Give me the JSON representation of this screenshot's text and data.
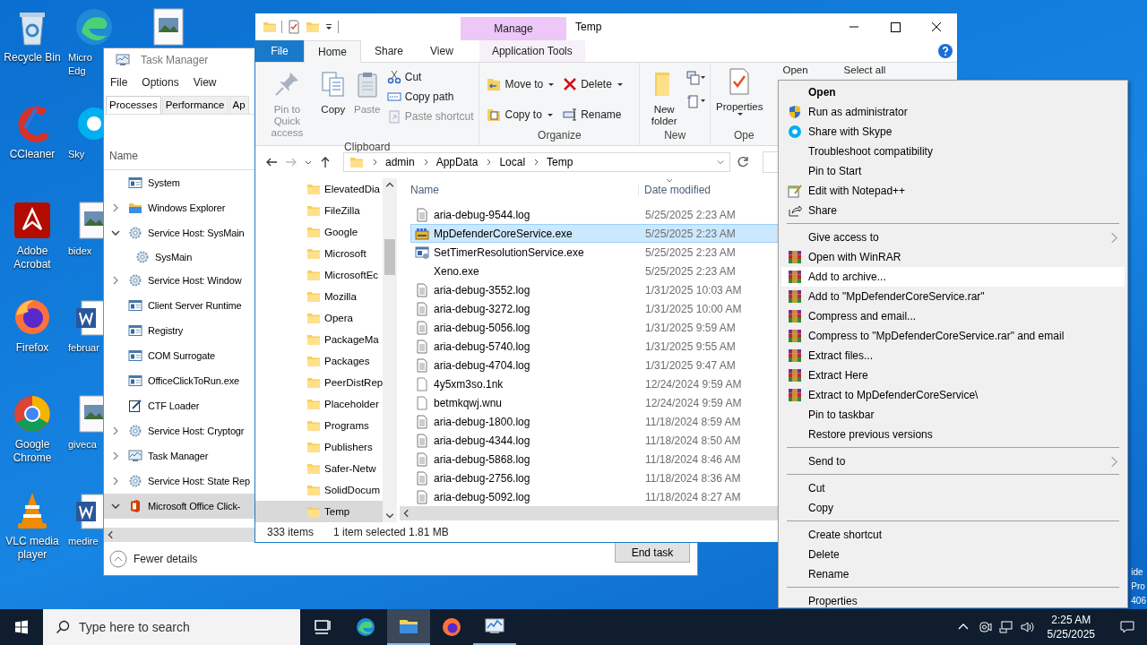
{
  "desktop_column_1": [
    {
      "label": "Recycle Bin",
      "kind": "recycle-bin"
    },
    {
      "label": "CCleaner",
      "kind": "ccleaner"
    },
    {
      "label": "Adobe Acrobat",
      "kind": "acrobat"
    },
    {
      "label": "Firefox",
      "kind": "firefox"
    },
    {
      "label": "Google Chrome",
      "kind": "chrome"
    },
    {
      "label": "VLC media player",
      "kind": "vlc"
    }
  ],
  "desktop_column_2": [
    {
      "label": "Micro Edg",
      "kind": "edge"
    },
    {
      "label": "Sky",
      "kind": "skype"
    },
    {
      "label": "bidex",
      "kind": "image"
    },
    {
      "label": "februar",
      "kind": "word"
    },
    {
      "label": "giveca",
      "kind": "image"
    },
    {
      "label": "medire",
      "kind": "word"
    }
  ],
  "desktop_corner_text": [
    "ide",
    "Pro",
    "406"
  ],
  "task_manager": {
    "title": "Task Manager",
    "menu": [
      "File",
      "Options",
      "View"
    ],
    "tabs": [
      {
        "label": "Processes",
        "selected": true
      },
      {
        "label": "Performance",
        "selected": false
      },
      {
        "label": "Ap",
        "selected": false
      }
    ],
    "column": "Name",
    "processes": [
      {
        "name": "System",
        "kind": "process",
        "selected": false
      },
      {
        "name": "Windows Explorer",
        "kind": "explorer",
        "expanded": false,
        "selected": false
      },
      {
        "name": "Service Host: SysMain",
        "kind": "service-host",
        "expanded": true,
        "selected": false,
        "children": [
          {
            "name": "SysMain",
            "kind": "service",
            "selected": false
          }
        ]
      },
      {
        "name": "Service Host: Window",
        "kind": "service-host",
        "expanded": false,
        "selected": false
      },
      {
        "name": "Client Server Runtime",
        "kind": "process",
        "selected": false
      },
      {
        "name": "Registry",
        "kind": "process",
        "selected": false
      },
      {
        "name": "COM Surrogate",
        "kind": "process",
        "selected": false
      },
      {
        "name": "OfficeClickToRun.exe",
        "kind": "process",
        "selected": false
      },
      {
        "name": "CTF Loader",
        "kind": "pen",
        "selected": false
      },
      {
        "name": "Service Host: Cryptogr",
        "kind": "service-host",
        "expanded": false,
        "selected": false
      },
      {
        "name": "Task Manager",
        "kind": "task-manager",
        "expanded": false,
        "selected": false
      },
      {
        "name": "Service Host: State Rep",
        "kind": "service-host",
        "expanded": false,
        "selected": false
      },
      {
        "name": "Microsoft Office Click-",
        "kind": "office",
        "expanded": true,
        "selected": true
      }
    ],
    "fewer_details": "Fewer details",
    "end_task": "End task"
  },
  "explorer": {
    "title": "Temp",
    "context_group": "Manage",
    "ribbon_tabs": [
      {
        "label": "File",
        "kind": "file",
        "selected": false
      },
      {
        "label": "Home",
        "kind": "tab",
        "selected": true
      },
      {
        "label": "Share",
        "kind": "tab",
        "selected": false
      },
      {
        "label": "View",
        "kind": "tab",
        "selected": false
      },
      {
        "label": "Application Tools",
        "kind": "context",
        "selected": false
      }
    ],
    "clipboard": {
      "label": "Clipboard",
      "large": [
        {
          "label": "Pin to Quick access",
          "kind": "pin",
          "disabled": true
        },
        {
          "label": "Copy",
          "kind": "copy",
          "disabled": false
        },
        {
          "label": "Paste",
          "kind": "paste",
          "disabled": true
        }
      ],
      "small": [
        {
          "label": "Cut",
          "kind": "cut",
          "disabled": false
        },
        {
          "label": "Copy path",
          "kind": "path",
          "disabled": false
        },
        {
          "label": "Paste shortcut",
          "kind": "shortcut",
          "disabled": true
        }
      ]
    },
    "organize": {
      "label": "Organize",
      "columns": [
        [
          {
            "label": "Move to",
            "kind": "move",
            "dropdown": true
          },
          {
            "label": "Copy to",
            "kind": "copyto",
            "dropdown": true
          }
        ],
        [
          {
            "label": "Delete",
            "kind": "delete",
            "dropdown": true
          },
          {
            "label": "Rename",
            "kind": "rename",
            "dropdown": false
          }
        ]
      ]
    },
    "new": {
      "label": "New",
      "large": "New folder"
    },
    "open": {
      "label": "Ope",
      "properties": "Properties",
      "small": [
        "Open",
        "Select all"
      ]
    },
    "address": [
      "admin",
      "AppData",
      "Local",
      "Temp"
    ],
    "nav": [
      {
        "label": "ElevatedDia",
        "selected": false
      },
      {
        "label": "FileZilla",
        "selected": false
      },
      {
        "label": "Google",
        "selected": false
      },
      {
        "label": "Microsoft",
        "selected": false
      },
      {
        "label": "MicrosoftEc",
        "selected": false
      },
      {
        "label": "Mozilla",
        "selected": false
      },
      {
        "label": "Opera",
        "selected": false
      },
      {
        "label": "PackageMa",
        "selected": false
      },
      {
        "label": "Packages",
        "selected": false
      },
      {
        "label": "PeerDistRep",
        "selected": false
      },
      {
        "label": "Placeholder",
        "selected": false
      },
      {
        "label": "Programs",
        "selected": false
      },
      {
        "label": "Publishers",
        "selected": false
      },
      {
        "label": "Safer-Netw",
        "selected": false
      },
      {
        "label": "SolidDocum",
        "selected": false
      },
      {
        "label": "Temp",
        "selected": true
      }
    ],
    "columns": [
      "Name",
      "Date modified"
    ],
    "files": [
      {
        "name": "aria-debug-9544.log",
        "date": "5/25/2025 2:23 AM",
        "kind": "log",
        "selected": false
      },
      {
        "name": "MpDefenderCoreService.exe",
        "date": "5/25/2025 2:23 AM",
        "kind": "package",
        "selected": true
      },
      {
        "name": "SetTimerResolutionService.exe",
        "date": "5/25/2025 2:23 AM",
        "kind": "program",
        "selected": false
      },
      {
        "name": "Xeno.exe",
        "date": "5/25/2025 2:23 AM",
        "kind": "none",
        "selected": false
      },
      {
        "name": "aria-debug-3552.log",
        "date": "1/31/2025 10:03 AM",
        "kind": "log",
        "selected": false
      },
      {
        "name": "aria-debug-3272.log",
        "date": "1/31/2025 10:00 AM",
        "kind": "log",
        "selected": false
      },
      {
        "name": "aria-debug-5056.log",
        "date": "1/31/2025 9:59 AM",
        "kind": "log",
        "selected": false
      },
      {
        "name": "aria-debug-5740.log",
        "date": "1/31/2025 9:55 AM",
        "kind": "log",
        "selected": false
      },
      {
        "name": "aria-debug-4704.log",
        "date": "1/31/2025 9:47 AM",
        "kind": "log",
        "selected": false
      },
      {
        "name": "4y5xm3so.1nk",
        "date": "12/24/2024 9:59 AM",
        "kind": "blank",
        "selected": false
      },
      {
        "name": "betmkqwj.wnu",
        "date": "12/24/2024 9:59 AM",
        "kind": "blank",
        "selected": false
      },
      {
        "name": "aria-debug-1800.log",
        "date": "11/18/2024 8:59 AM",
        "kind": "log",
        "selected": false
      },
      {
        "name": "aria-debug-4344.log",
        "date": "11/18/2024 8:50 AM",
        "kind": "log",
        "selected": false
      },
      {
        "name": "aria-debug-5868.log",
        "date": "11/18/2024 8:46 AM",
        "kind": "log",
        "selected": false
      },
      {
        "name": "aria-debug-2756.log",
        "date": "11/18/2024 8:36 AM",
        "kind": "log",
        "selected": false
      },
      {
        "name": "aria-debug-5092.log",
        "date": "11/18/2024 8:27 AM",
        "kind": "log",
        "selected": false
      }
    ],
    "status": {
      "count": "333 items",
      "selection": "1 item selected  1.81 MB"
    }
  },
  "context_menu": {
    "sections": [
      [
        {
          "label": "Open",
          "kind": "plain",
          "default": true,
          "submenu": false,
          "selected": false
        },
        {
          "label": "Run as administrator",
          "kind": "shield",
          "default": false,
          "submenu": false,
          "selected": false
        },
        {
          "label": "Share with Skype",
          "kind": "skype",
          "default": false,
          "submenu": false,
          "selected": false
        },
        {
          "label": "Troubleshoot compatibility",
          "kind": "plain",
          "default": false,
          "submenu": false,
          "selected": false
        },
        {
          "label": "Pin to Start",
          "kind": "plain",
          "default": false,
          "submenu": false,
          "selected": false
        },
        {
          "label": "Edit with Notepad++",
          "kind": "notepad",
          "default": false,
          "submenu": false,
          "selected": false
        },
        {
          "label": "Share",
          "kind": "share",
          "default": false,
          "submenu": false,
          "selected": false
        }
      ],
      [
        {
          "label": "Give access to",
          "kind": "plain",
          "default": false,
          "submenu": true,
          "selected": false
        },
        {
          "label": "Open with WinRAR",
          "kind": "winrar",
          "default": false,
          "submenu": false,
          "selected": false
        },
        {
          "label": "Add to archive...",
          "kind": "winrar",
          "default": false,
          "submenu": false,
          "selected": true
        },
        {
          "label": "Add to \"MpDefenderCoreService.rar\"",
          "kind": "winrar",
          "default": false,
          "submenu": false,
          "selected": false
        },
        {
          "label": "Compress and email...",
          "kind": "winrar",
          "default": false,
          "submenu": false,
          "selected": false
        },
        {
          "label": "Compress to \"MpDefenderCoreService.rar\" and email",
          "kind": "winrar",
          "default": false,
          "submenu": false,
          "selected": false
        },
        {
          "label": "Extract files...",
          "kind": "winrar",
          "default": false,
          "submenu": false,
          "selected": false
        },
        {
          "label": "Extract Here",
          "kind": "winrar",
          "default": false,
          "submenu": false,
          "selected": false
        },
        {
          "label": "Extract to MpDefenderCoreService\\",
          "kind": "winrar",
          "default": false,
          "submenu": false,
          "selected": false
        },
        {
          "label": "Pin to taskbar",
          "kind": "plain",
          "default": false,
          "submenu": false,
          "selected": false
        },
        {
          "label": "Restore previous versions",
          "kind": "plain",
          "default": false,
          "submenu": false,
          "selected": false
        }
      ],
      [
        {
          "label": "Send to",
          "kind": "plain",
          "default": false,
          "submenu": true,
          "selected": false
        }
      ],
      [
        {
          "label": "Cut",
          "kind": "plain",
          "default": false,
          "submenu": false,
          "selected": false
        },
        {
          "label": "Copy",
          "kind": "plain",
          "default": false,
          "submenu": false,
          "selected": false
        }
      ],
      [
        {
          "label": "Create shortcut",
          "kind": "plain",
          "default": false,
          "submenu": false,
          "selected": false
        },
        {
          "label": "Delete",
          "kind": "plain",
          "default": false,
          "submenu": false,
          "selected": false
        },
        {
          "label": "Rename",
          "kind": "plain",
          "default": false,
          "submenu": false,
          "selected": false
        }
      ],
      [
        {
          "label": "Properties",
          "kind": "plain",
          "default": false,
          "submenu": false,
          "selected": false
        }
      ]
    ]
  },
  "taskbar": {
    "search": {
      "placeholder": "Type here to search"
    },
    "apps": [
      {
        "kind": "task-view",
        "active": false,
        "running": false
      },
      {
        "kind": "edge",
        "active": false,
        "running": false
      },
      {
        "kind": "explorer",
        "active": true,
        "running": true
      },
      {
        "kind": "firefox",
        "active": false,
        "running": false
      },
      {
        "kind": "task-manager",
        "active": false,
        "running": true
      }
    ],
    "time": "2:25 AM",
    "date": "5/25/2025"
  }
}
